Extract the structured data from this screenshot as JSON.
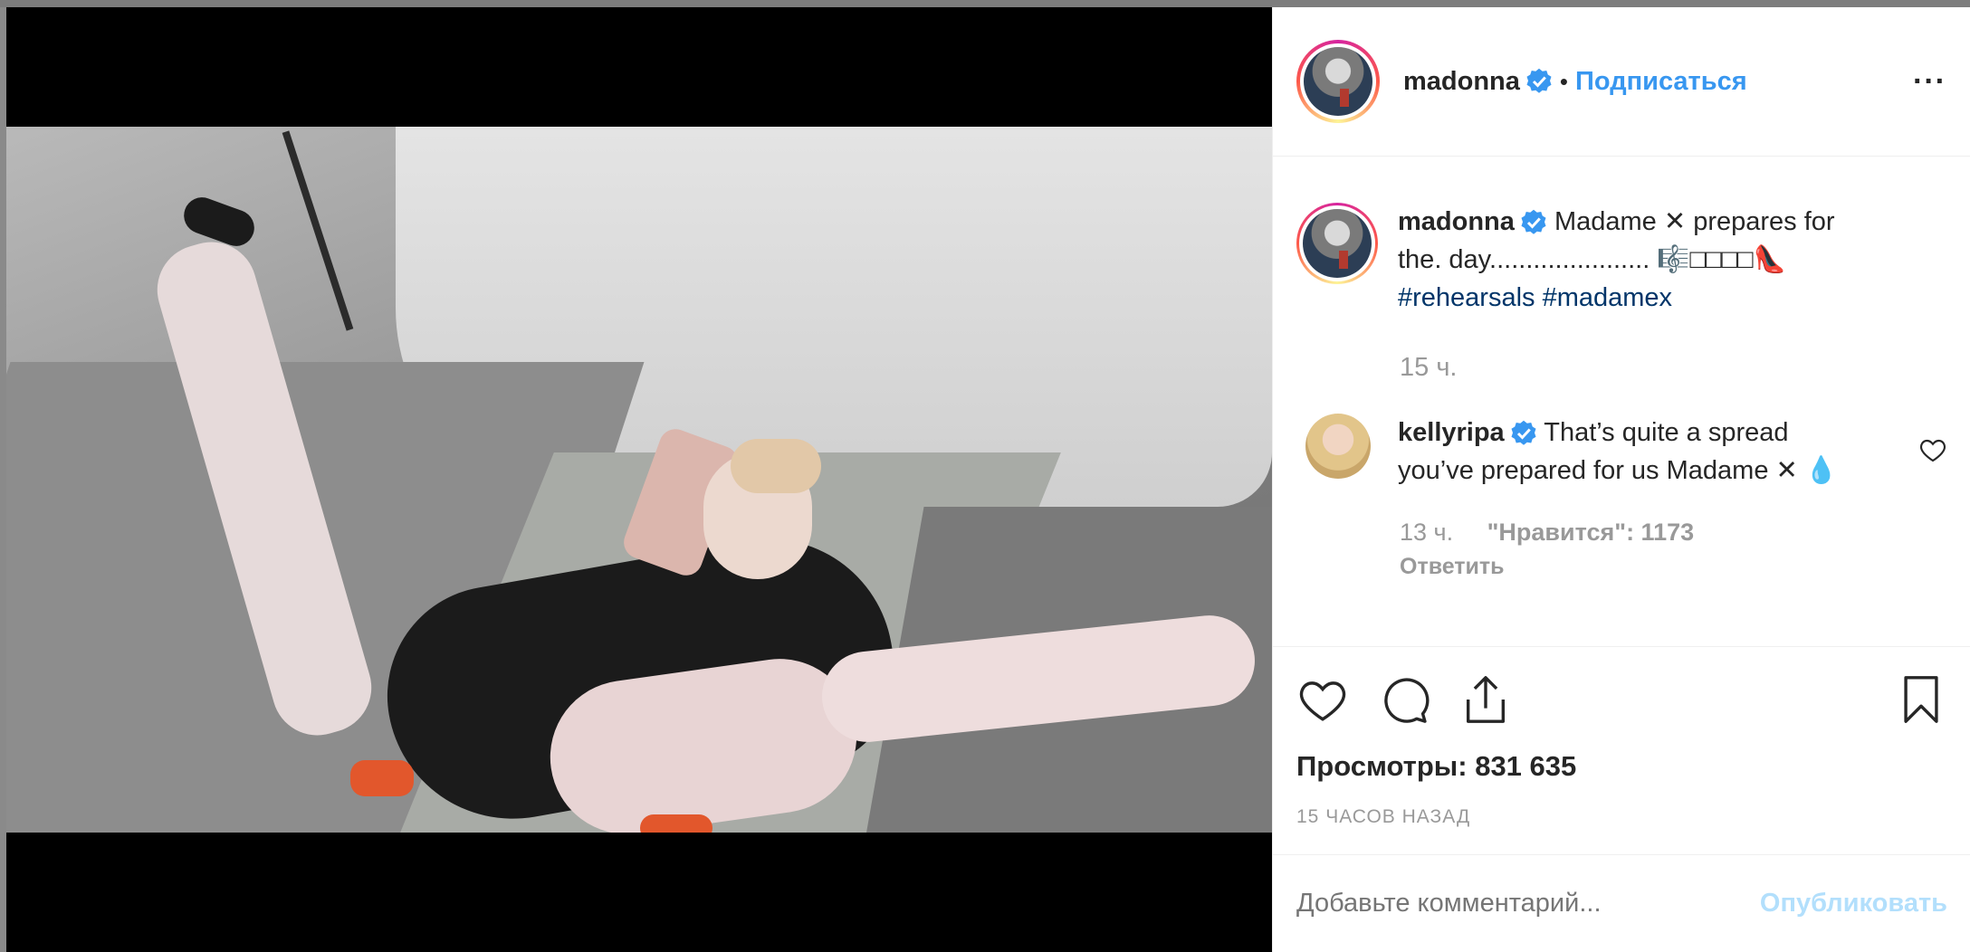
{
  "post": {
    "author": "madonna",
    "follow_label": "Подписаться",
    "dot": "•",
    "more_label": "···",
    "caption": {
      "username": "madonna",
      "text_line1": "Madame ✕ prepares for",
      "text_line2": "the. day...................... 🎼□□□□👠",
      "hashtag1": "#rehearsals",
      "hashtag2": "#madamex",
      "time": "15 ч."
    },
    "comment": {
      "username": "kellyripa",
      "text": "That’s quite a spread you’ve prepared for us Madame ✕ 💧",
      "time": "13 ч.",
      "likes": "\"Нравится\": 1173",
      "reply_label": "Ответить"
    },
    "views": "Просмотры: 831 635",
    "posted": "15 часов назад",
    "add_comment_placeholder": "Добавьте комментарий...",
    "publish_label": "Опубликовать"
  },
  "colors": {
    "accent": "#3897f0",
    "hashtag": "#003569",
    "muted": "#999999",
    "publish_disabled": "#b2dffc"
  },
  "icons": [
    "verified-badge-icon",
    "more-options-icon",
    "heart-icon",
    "comment-icon",
    "share-icon",
    "bookmark-icon"
  ]
}
